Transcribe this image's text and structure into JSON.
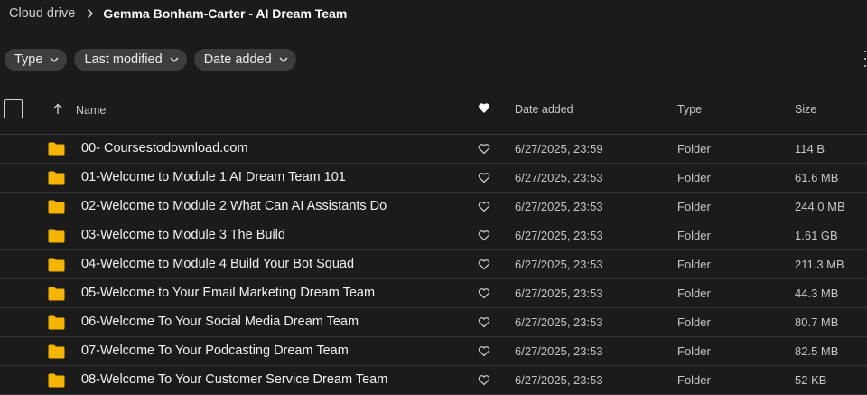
{
  "breadcrumb": {
    "root": "Cloud drive",
    "current": "Gemma Bonham-Carter - AI Dream Team"
  },
  "filters": [
    {
      "label": "Type"
    },
    {
      "label": "Last modified"
    },
    {
      "label": "Date added"
    }
  ],
  "columns": {
    "name": "Name",
    "date_added": "Date added",
    "type": "Type",
    "size": "Size"
  },
  "colors": {
    "folder": "#f5b400",
    "background": "#1b1b1b",
    "chip": "#3d3d3d"
  },
  "rows": [
    {
      "name": "00- Coursestodownload.com",
      "date": "6/27/2025, 23:59",
      "type": "Folder",
      "size": "114 B"
    },
    {
      "name": "01-Welcome to Module 1 AI Dream Team 101",
      "date": "6/27/2025, 23:53",
      "type": "Folder",
      "size": "61.6 MB"
    },
    {
      "name": "02-Welcome to Module 2 What Can AI Assistants Do",
      "date": "6/27/2025, 23:53",
      "type": "Folder",
      "size": "244.0 MB"
    },
    {
      "name": "03-Welcome to Module 3 The Build",
      "date": "6/27/2025, 23:53",
      "type": "Folder",
      "size": "1.61 GB"
    },
    {
      "name": "04-Welcome to Module 4 Build Your Bot Squad",
      "date": "6/27/2025, 23:53",
      "type": "Folder",
      "size": "211.3 MB"
    },
    {
      "name": "05-Welcome to Your Email Marketing Dream Team",
      "date": "6/27/2025, 23:53",
      "type": "Folder",
      "size": "44.3 MB"
    },
    {
      "name": "06-Welcome To Your Social Media Dream Team",
      "date": "6/27/2025, 23:53",
      "type": "Folder",
      "size": "80.7 MB"
    },
    {
      "name": "07-Welcome To Your Podcasting Dream Team",
      "date": "6/27/2025, 23:53",
      "type": "Folder",
      "size": "82.5 MB"
    },
    {
      "name": "08-Welcome To Your Customer Service Dream Team",
      "date": "6/27/2025, 23:53",
      "type": "Folder",
      "size": "52 KB"
    }
  ]
}
